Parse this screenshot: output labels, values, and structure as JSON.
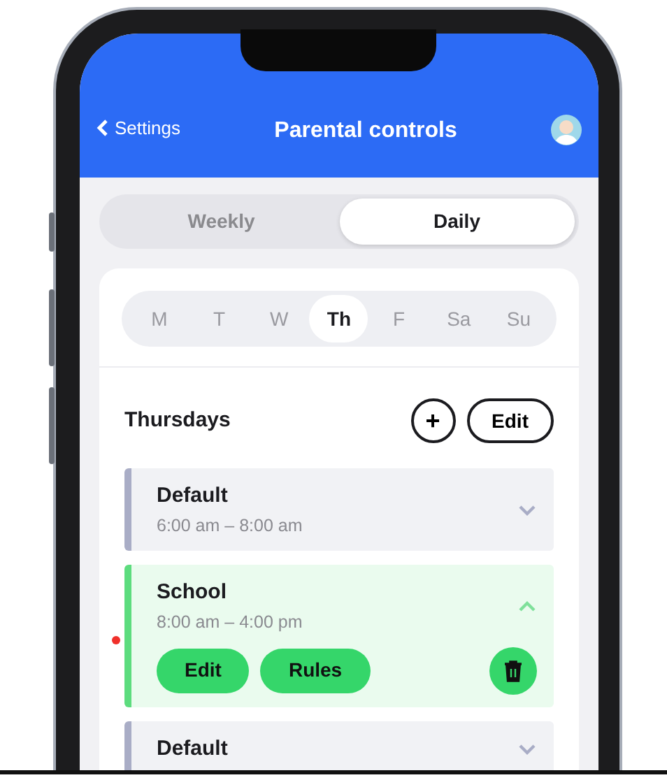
{
  "header": {
    "back_label": "Settings",
    "title": "Parental controls"
  },
  "view_tabs": [
    {
      "label": "Weekly",
      "selected": false
    },
    {
      "label": "Daily",
      "selected": true
    }
  ],
  "days": [
    {
      "label": "M",
      "selected": false
    },
    {
      "label": "T",
      "selected": false
    },
    {
      "label": "W",
      "selected": false
    },
    {
      "label": "Th",
      "selected": true
    },
    {
      "label": "F",
      "selected": false
    },
    {
      "label": "Sa",
      "selected": false
    },
    {
      "label": "Su",
      "selected": false
    }
  ],
  "section": {
    "title": "Thursdays",
    "add_symbol": "+",
    "edit_label": "Edit"
  },
  "schedules": [
    {
      "name": "Default",
      "time": "6:00 am – 8:00 am",
      "color": "#a9adc6",
      "expanded": false,
      "current": false
    },
    {
      "name": "School",
      "time": "8:00 am – 4:00 pm",
      "color": "#5ddc7e",
      "expanded": true,
      "current": true,
      "actions": [
        "Edit",
        "Rules"
      ]
    },
    {
      "name": "Default",
      "color": "#a9adc6",
      "expanded": false,
      "current": false
    }
  ]
}
